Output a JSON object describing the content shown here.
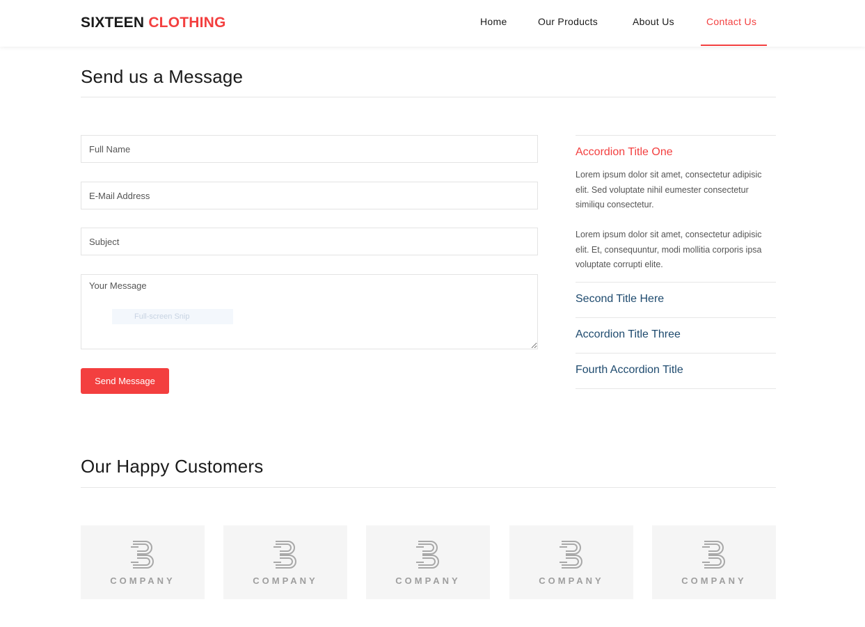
{
  "brand": {
    "part1": "SIXTEEN",
    "part2": "CLOTHING"
  },
  "nav": [
    {
      "label": "Home",
      "active": false
    },
    {
      "label": "Our Products",
      "active": false
    },
    {
      "label": "About Us",
      "active": false
    },
    {
      "label": "Contact Us",
      "active": true
    }
  ],
  "contact": {
    "title": "Send us a Message",
    "fields": {
      "name_placeholder": "Full Name",
      "email_placeholder": "E-Mail Address",
      "subject_placeholder": "Subject",
      "message_placeholder": "Your Message"
    },
    "overlay_label": "Full-screen Snip",
    "submit_label": "Send Message"
  },
  "accordion": [
    {
      "title": "Accordion Title One",
      "open": true,
      "paragraphs": [
        "Lorem ipsum dolor sit amet, consectetur adipisic elit. Sed voluptate nihil eumester consectetur similiqu consectetur.",
        "Lorem ipsum dolor sit amet, consectetur adipisic elit. Et, consequuntur, modi mollitia corporis ipsa voluptate corrupti elite."
      ]
    },
    {
      "title": "Second Title Here",
      "open": false
    },
    {
      "title": "Accordion Title Three",
      "open": false
    },
    {
      "title": "Fourth Accordion Title",
      "open": false
    }
  ],
  "customers": {
    "title": "Our Happy Customers",
    "logos": [
      {
        "word": "COMPANY",
        "icon": "company-b-logo-icon"
      },
      {
        "word": "COMPANY",
        "icon": "company-b-logo-icon"
      },
      {
        "word": "COMPANY",
        "icon": "company-b-logo-icon"
      },
      {
        "word": "COMPANY",
        "icon": "company-b-logo-icon"
      },
      {
        "word": "COMPANY",
        "icon": "company-b-logo-icon"
      }
    ]
  },
  "colors": {
    "accent": "#f33f3f",
    "link": "#1e4a6e",
    "card_bg": "#f5f5f5"
  }
}
